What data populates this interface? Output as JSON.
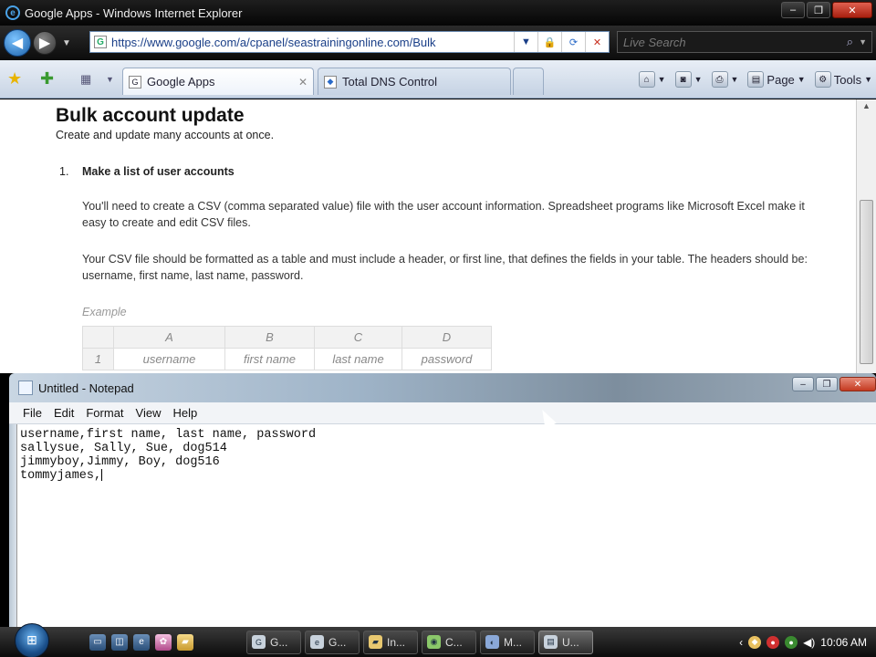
{
  "browser": {
    "title": "Google Apps - Windows Internet Explorer",
    "url": "https://www.google.com/a/cpanel/seastrainingonline.com/Bulk",
    "search_placeholder": "Live Search",
    "tabs": [
      {
        "label": "Google Apps"
      },
      {
        "label": "Total DNS Control"
      }
    ],
    "tools": {
      "page": "Page",
      "tools": "Tools"
    }
  },
  "page": {
    "heading": "Bulk account update",
    "subheading": "Create and update many accounts at once.",
    "step_number": "1.",
    "step_title": "Make a list of user accounts",
    "para1": "You'll need to create a CSV (comma separated value) file with the user account information. Spreadsheet programs like Microsoft Excel make it easy to create and edit CSV files.",
    "para2": "Your CSV file should be formatted as a table and must include a header, or first line, that defines the fields in your table. The headers should be: username, first name, last name, password.",
    "example_label": "Example",
    "example_table": {
      "columns": [
        "A",
        "B",
        "C",
        "D"
      ],
      "row_number": "1",
      "row": [
        "username",
        "first name",
        "last name",
        "password"
      ]
    }
  },
  "notepad": {
    "title": "Untitled - Notepad",
    "menu": [
      "File",
      "Edit",
      "Format",
      "View",
      "Help"
    ],
    "lines": [
      "username,first name, last name, password",
      "sallysue, Sally, Sue, dog514",
      "jimmyboy,Jimmy, Boy, dog516",
      "tommyjames,"
    ]
  },
  "taskbar": {
    "tasks": [
      {
        "label": "G..."
      },
      {
        "label": "G..."
      },
      {
        "label": "In..."
      },
      {
        "label": "C..."
      },
      {
        "label": "M..."
      },
      {
        "label": "U..."
      }
    ],
    "clock": "10:06 AM"
  }
}
